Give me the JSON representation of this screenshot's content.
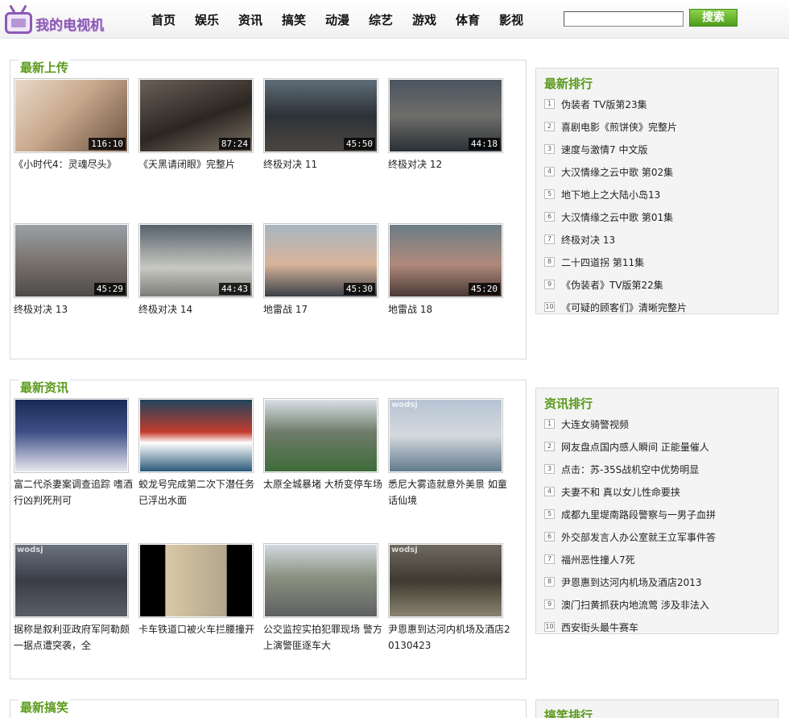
{
  "header": {
    "logo_text": "我的电视机",
    "nav": [
      "首页",
      "娱乐",
      "资讯",
      "搞笑",
      "动漫",
      "综艺",
      "游戏",
      "体育",
      "影视"
    ],
    "search_value": "",
    "search_button": "搜索"
  },
  "sections": {
    "latest_upload": {
      "title": "最新上传",
      "items": [
        {
          "title": "《小时代4：灵魂尽头》",
          "duration": "116:10",
          "watermark": ""
        },
        {
          "title": "《天黑请闭眼》完整片",
          "duration": "87:24",
          "watermark": ""
        },
        {
          "title": "终极对决 11",
          "duration": "45:50",
          "watermark": ""
        },
        {
          "title": "终极对决 12",
          "duration": "44:18",
          "watermark": ""
        },
        {
          "title": "终极对决 13",
          "duration": "45:29",
          "watermark": ""
        },
        {
          "title": "终极对决 14",
          "duration": "44:43",
          "watermark": ""
        },
        {
          "title": "地雷战 17",
          "duration": "45:30",
          "watermark": ""
        },
        {
          "title": "地雷战 18",
          "duration": "45:20",
          "watermark": ""
        }
      ]
    },
    "latest_news": {
      "title": "最新资讯",
      "items": [
        {
          "title": "富二代杀妻案调查追踪 嗜酒行凶判死刑可",
          "duration": "",
          "watermark": ""
        },
        {
          "title": "蛟龙号完成第二次下潜任务已浮出水面",
          "duration": "",
          "watermark": ""
        },
        {
          "title": "太原全城暴堵 大桥变停车场",
          "duration": "",
          "watermark": ""
        },
        {
          "title": "悉尼大雾造就意外美景 如童话仙境",
          "duration": "",
          "watermark": "wodsj"
        },
        {
          "title": "据称是叙利亚政府军阿勒颇一据点遭突袭，全",
          "duration": "",
          "watermark": "wodsj"
        },
        {
          "title": "卡车铁道口被火车拦腰撞开",
          "duration": "",
          "watermark": ""
        },
        {
          "title": "公交监控实拍犯罪现场 警方上演警匪逐车大",
          "duration": "",
          "watermark": ""
        },
        {
          "title": "尹恩惠到达河内机场及酒店20130423",
          "duration": "",
          "watermark": "wodsj"
        }
      ]
    },
    "latest_funny": {
      "title": "最新搞笑"
    }
  },
  "rankings": {
    "latest": {
      "title": "最新排行",
      "items": [
        "伪装者 TV版第23集",
        "喜剧电影《煎饼侠》完整片",
        "速度与激情7 中文版",
        "大汉情缘之云中歌 第02集",
        "地下地上之大陆小岛13",
        "大汉情缘之云中歌 第01集",
        "终极对决 13",
        "二十四道拐 第11集",
        "《伪装者》TV版第22集",
        "《可疑的顾客们》清晰完整片"
      ]
    },
    "news": {
      "title": "资讯排行",
      "items": [
        "大连女骑警视频",
        "网友盘点国内感人瞬间 正能量催人",
        "点击：苏-35S战机空中优势明显",
        "夫妻不和 真以女儿性命要挟",
        "成都九里堤南路段警察与一男子血拼",
        "外交部发言人办公室就王立军事件答",
        "福州恶性撞人7死",
        "尹恩惠到达河内机场及酒店2013",
        "澳门扫黄抓获内地流莺 涉及非法入",
        "西安街头最牛赛车"
      ]
    },
    "funny": {
      "title": "搞笑排行"
    }
  }
}
